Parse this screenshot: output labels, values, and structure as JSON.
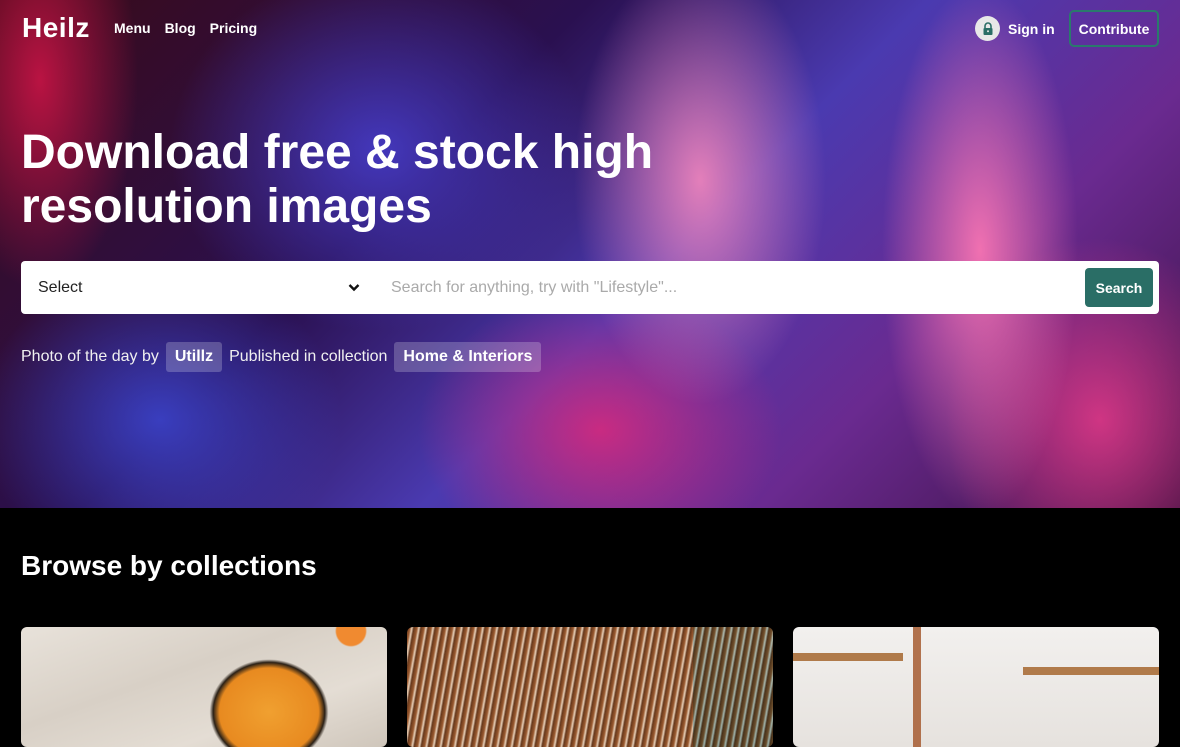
{
  "nav": {
    "logo": "Heilz",
    "links": [
      "Menu",
      "Blog",
      "Pricing"
    ],
    "sign_in": "Sign in",
    "contribute": "Contribute"
  },
  "hero": {
    "headline_line1": "Download free & stock high",
    "headline_line2": "resolution images",
    "select_value": "Select",
    "search_placeholder": "Search for anything, try with \"Lifestyle\"...",
    "search_button": "Search",
    "credit": {
      "prefix": "Photo of the day by",
      "author": "Utillz",
      "middle": "Published in collection",
      "collection": "Home & Interiors"
    }
  },
  "browse": {
    "title": "Browse by collections",
    "cards": [
      {
        "subject": "peach-tart-photo"
      },
      {
        "subject": "dried-palm-leaf-photo"
      },
      {
        "subject": "kitchen-shelves-photo"
      }
    ]
  },
  "colors": {
    "accent": "#2a6e66",
    "contribute_border": "#2a7a6c"
  }
}
